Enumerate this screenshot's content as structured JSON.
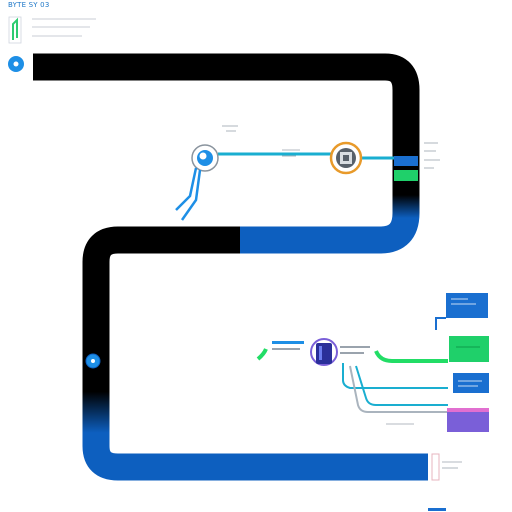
{
  "header": {
    "title": "BYTE SY 03"
  },
  "colors": {
    "track_black": "#000000",
    "track_blue": "#0d5fbf",
    "connector_green": "#22dd66",
    "connector_teal": "#1aaed0",
    "node_blue": "#1e8fe6",
    "panel_blue": "#1a6fd0",
    "panel_green": "#1fd06a",
    "panel_purple": "#7a5fd8"
  },
  "icons": [
    "header-logo-icon",
    "start-node-icon",
    "globe-node-icon",
    "processor-node-icon",
    "entry-node-icon",
    "database-node-icon"
  ]
}
